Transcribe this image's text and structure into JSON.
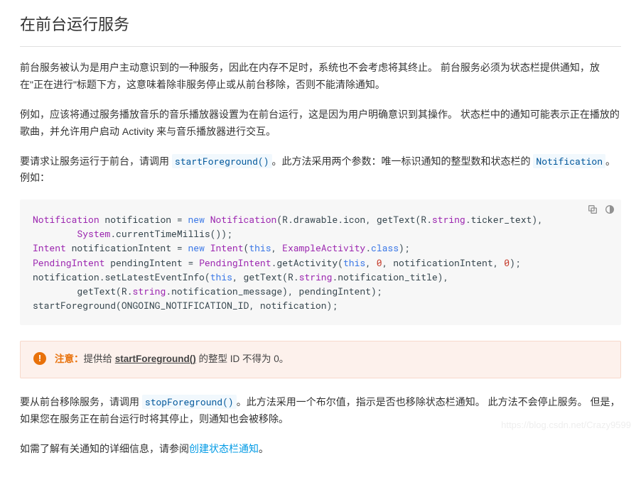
{
  "title": "在前台运行服务",
  "para1": "前台服务被认为是用户主动意识到的一种服务，因此在内存不足时，系统也不会考虑将其终止。 前台服务必须为状态栏提供通知，放在\"正在进行\"标题下方，这意味着除非服务停止或从前台移除，否则不能清除通知。",
  "para2": "例如，应该将通过服务播放音乐的音乐播放器设置为在前台运行，这是因为用户明确意识到其操作。 状态栏中的通知可能表示正在播放的歌曲，并允许用户启动 Activity 来与音乐播放器进行交互。",
  "para3_a": "要请求让服务运行于前台，请调用 ",
  "para3_code1": "startForeground()",
  "para3_b": "。此方法采用两个参数：唯一标识通知的整型数和状态栏的 ",
  "para3_code2": "Notification",
  "para3_c": "。例如：",
  "code_tokens": [
    [
      [
        "type",
        "Notification"
      ],
      [
        "plain",
        " notification "
      ],
      [
        "plain",
        "="
      ],
      [
        "plain",
        " "
      ],
      [
        "kw",
        "new"
      ],
      [
        "plain",
        " "
      ],
      [
        "type",
        "Notification"
      ],
      [
        "plain",
        "("
      ],
      [
        "plain",
        "R"
      ],
      [
        "plain",
        "."
      ],
      [
        "plain",
        "drawable"
      ],
      [
        "plain",
        "."
      ],
      [
        "plain",
        "icon"
      ],
      [
        "plain",
        ","
      ],
      [
        "plain",
        " getText"
      ],
      [
        "plain",
        "("
      ],
      [
        "plain",
        "R"
      ],
      [
        "plain",
        "."
      ],
      [
        "pkg",
        "string"
      ],
      [
        "plain",
        "."
      ],
      [
        "plain",
        "ticker_text"
      ],
      [
        "plain",
        "),"
      ]
    ],
    [
      [
        "plain",
        "        "
      ],
      [
        "type",
        "System"
      ],
      [
        "plain",
        "."
      ],
      [
        "plain",
        "currentTimeMillis"
      ],
      [
        "plain",
        "());"
      ]
    ],
    [
      [
        "type",
        "Intent"
      ],
      [
        "plain",
        " notificationIntent "
      ],
      [
        "plain",
        "="
      ],
      [
        "plain",
        " "
      ],
      [
        "kw",
        "new"
      ],
      [
        "plain",
        " "
      ],
      [
        "type",
        "Intent"
      ],
      [
        "plain",
        "("
      ],
      [
        "kw",
        "this"
      ],
      [
        "plain",
        ","
      ],
      [
        "plain",
        " "
      ],
      [
        "type",
        "ExampleActivity"
      ],
      [
        "plain",
        "."
      ],
      [
        "kw",
        "class"
      ],
      [
        "plain",
        ");"
      ]
    ],
    [
      [
        "type",
        "PendingIntent"
      ],
      [
        "plain",
        " pendingIntent "
      ],
      [
        "plain",
        "="
      ],
      [
        "plain",
        " "
      ],
      [
        "type",
        "PendingIntent"
      ],
      [
        "plain",
        "."
      ],
      [
        "plain",
        "getActivity"
      ],
      [
        "plain",
        "("
      ],
      [
        "kw",
        "this"
      ],
      [
        "plain",
        ","
      ],
      [
        "plain",
        " "
      ],
      [
        "num",
        "0"
      ],
      [
        "plain",
        ","
      ],
      [
        "plain",
        " notificationIntent"
      ],
      [
        "plain",
        ","
      ],
      [
        "plain",
        " "
      ],
      [
        "num",
        "0"
      ],
      [
        "plain",
        ");"
      ]
    ],
    [
      [
        "plain",
        "notification"
      ],
      [
        "plain",
        "."
      ],
      [
        "plain",
        "setLatestEventInfo"
      ],
      [
        "plain",
        "("
      ],
      [
        "kw",
        "this"
      ],
      [
        "plain",
        ","
      ],
      [
        "plain",
        " getText"
      ],
      [
        "plain",
        "("
      ],
      [
        "plain",
        "R"
      ],
      [
        "plain",
        "."
      ],
      [
        "pkg",
        "string"
      ],
      [
        "plain",
        "."
      ],
      [
        "plain",
        "notification_title"
      ],
      [
        "plain",
        "),"
      ]
    ],
    [
      [
        "plain",
        "        getText"
      ],
      [
        "plain",
        "("
      ],
      [
        "plain",
        "R"
      ],
      [
        "plain",
        "."
      ],
      [
        "pkg",
        "string"
      ],
      [
        "plain",
        "."
      ],
      [
        "plain",
        "notification_message"
      ],
      [
        "plain",
        "),"
      ],
      [
        "plain",
        " pendingIntent"
      ],
      [
        "plain",
        ");"
      ]
    ],
    [
      [
        "plain",
        "startForeground"
      ],
      [
        "plain",
        "("
      ],
      [
        "plain",
        "ONGOING_NOTIFICATION_ID"
      ],
      [
        "plain",
        ","
      ],
      [
        "plain",
        " notification"
      ],
      [
        "plain",
        ");"
      ]
    ]
  ],
  "note_label": "注意：",
  "note_a": "提供给 ",
  "note_fn": "startForeground()",
  "note_b": " 的整型 ID 不得为 0。",
  "para4_a": "要从前台移除服务，请调用 ",
  "para4_code": "stopForeground()",
  "para4_b": "。此方法采用一个布尔值，指示是否也移除状态栏通知。 此方法不会停止服务。 但是，如果您在服务正在前台运行时将其停止，则通知也会被移除。",
  "para5_a": "如需了解有关通知的详细信息，请参阅",
  "para5_link": "创建状态栏通知",
  "para5_b": "。",
  "icons": {
    "copy": "copy-icon",
    "theme": "theme-icon",
    "warn": "!"
  },
  "watermark": "https://blog.csdn.net/Crazy9599"
}
